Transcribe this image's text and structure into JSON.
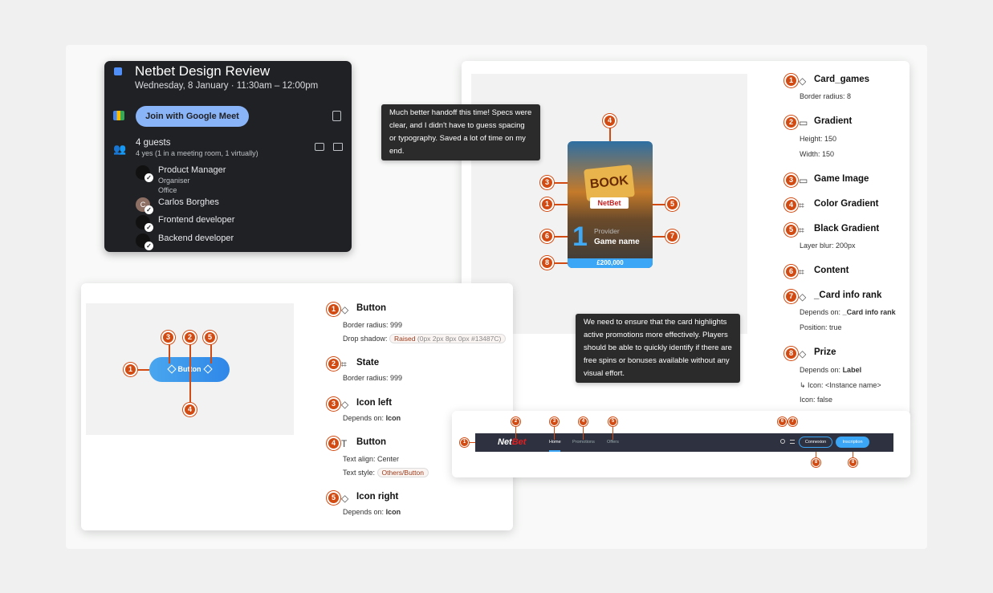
{
  "calendar": {
    "title": "Netbet Design Review",
    "datetime": "Wednesday, 8 January  ·  11:30am – 12:00pm",
    "join_label": "Join with Google Meet",
    "guests_count": "4 guests",
    "guests_summary": "4 yes (1 in a meeting room, 1 virtually)",
    "guests": [
      {
        "name": "Product Manager",
        "role": "Organiser",
        "location": "Office"
      },
      {
        "name": "Carlos Borghes",
        "initial": "C"
      },
      {
        "name": "Frontend developer"
      },
      {
        "name": "Backend developer"
      }
    ]
  },
  "comments": {
    "first": "Much better handoff this time! Specs were clear, and I didn't have to guess spacing or typography. Saved a lot of time on my end.",
    "second": "We need to ensure that the card highlights active promotions more effectively. Players should be able to quickly identify if there are free spins or bonuses available without any visual effort."
  },
  "game_card": {
    "title_word": "BOOK",
    "brand": "NetBet",
    "rank": "1",
    "provider": "Provider",
    "game_name": "Game name",
    "prize": "£200,000"
  },
  "card_specs": [
    {
      "num": "1",
      "icon": "◇",
      "name": "Card_games",
      "props": [
        "Border radius: 8"
      ]
    },
    {
      "num": "2",
      "icon": "▭",
      "name": "Gradient",
      "props": [
        "Height: 150",
        "Width: 150"
      ]
    },
    {
      "num": "3",
      "icon": "▭",
      "name": "Game Image",
      "props": []
    },
    {
      "num": "4",
      "icon": "⌗",
      "name": "Color Gradient",
      "props": []
    },
    {
      "num": "5",
      "icon": "⌗",
      "name": "Black Gradient",
      "props": [
        "Layer blur: 200px"
      ]
    },
    {
      "num": "6",
      "icon": "⌗",
      "name": "Content",
      "props": []
    },
    {
      "num": "7",
      "icon": "◇",
      "name": "_Card info rank",
      "props": [
        "Depends on:",
        "Position: true"
      ],
      "depends": "_Card info rank"
    },
    {
      "num": "8",
      "icon": "◇",
      "name": "Prize",
      "props": [
        "Depends on:",
        "↳ Icon: <Instance name>",
        "Icon: false"
      ],
      "depends": "Label"
    }
  ],
  "button_demo": {
    "label": "Button"
  },
  "button_specs": [
    {
      "num": "1",
      "icon": "◇",
      "name": "Button",
      "p1": "Border radius: 999",
      "p2_label": "Drop shadow:",
      "p2_pill": "Raised",
      "p2_pill_extra": "(0px 2px 8px 0px #13487C)"
    },
    {
      "num": "2",
      "icon": "⌗",
      "name": "State",
      "p1": "Border radius: 999"
    },
    {
      "num": "3",
      "icon": "◇",
      "name": "Icon left",
      "p1": "Depends on:",
      "p1_bold": "Icon"
    },
    {
      "num": "4",
      "icon": "T",
      "name": "Button",
      "p1": "Text align: Center",
      "p2_label": "Text style:",
      "p2_pill": "Others/Button"
    },
    {
      "num": "5",
      "icon": "◇",
      "name": "Icon right",
      "p1": "Depends on:",
      "p1_bold": "Icon"
    }
  ],
  "navbar": {
    "logo_a": "Net",
    "logo_b": "Bet",
    "items": [
      "Home",
      "Promotions",
      "Offers"
    ],
    "login": "Connexion",
    "signup": "Inscription"
  },
  "markers": [
    "1",
    "2",
    "3",
    "4",
    "5",
    "6",
    "7",
    "8"
  ],
  "colors": {
    "accent": "#d14b12",
    "primary_blue": "#3aa6f5",
    "dark": "#202124"
  }
}
